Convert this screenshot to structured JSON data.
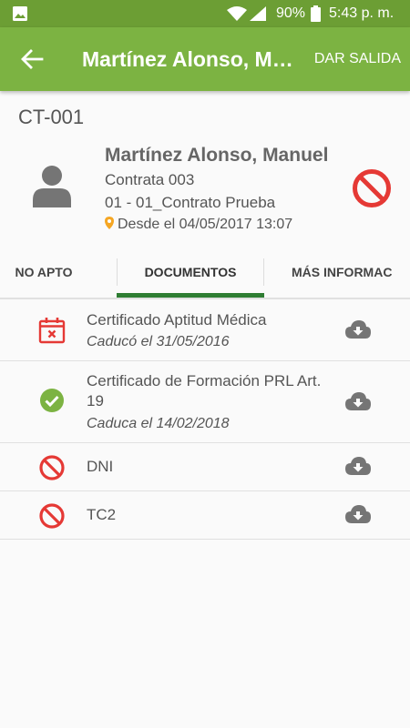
{
  "status_bar": {
    "battery_percent": "90%",
    "time": "5:43 p. m.",
    "icons": [
      "gallery-icon",
      "wifi-icon",
      "signal-icon",
      "battery-icon"
    ]
  },
  "app_bar": {
    "back_icon": "arrow-left-icon",
    "title": "Martínez Alonso, Manuel",
    "action_label": "DAR SALIDA"
  },
  "worker": {
    "code": "CT-001",
    "name": "Martínez Alonso, Manuel",
    "company": "Contrata 003",
    "contract": "01 - 01_Contrato Prueba",
    "since": "Desde el 04/05/2017 13:07",
    "status_icon": "blocked-icon"
  },
  "tabs": {
    "items": [
      {
        "label": "NO APTO"
      },
      {
        "label": "DOCUMENTOS"
      },
      {
        "label": "MÁS INFORMACIÓN"
      }
    ],
    "active_index": 1
  },
  "documents": [
    {
      "name": "Certificado Aptitud Médica",
      "date": "Caducó el 31/05/2016",
      "status_icon": "calendar-expired-icon"
    },
    {
      "name": "Certificado de Formación PRL Art. 19",
      "date": "Caduca el 14/02/2018",
      "status_icon": "check-circle-icon"
    },
    {
      "name": "DNI",
      "date": "",
      "status_icon": "blocked-icon"
    },
    {
      "name": "TC2",
      "date": "",
      "status_icon": "blocked-icon"
    }
  ],
  "colors": {
    "status_bar": "#6c9e34",
    "app_bar": "#7cb342",
    "tab_indicator": "#2e7d32",
    "error_red": "#e53935",
    "ok_green": "#7cb342",
    "pin_orange": "#f5a623",
    "icon_grey": "#757575"
  }
}
